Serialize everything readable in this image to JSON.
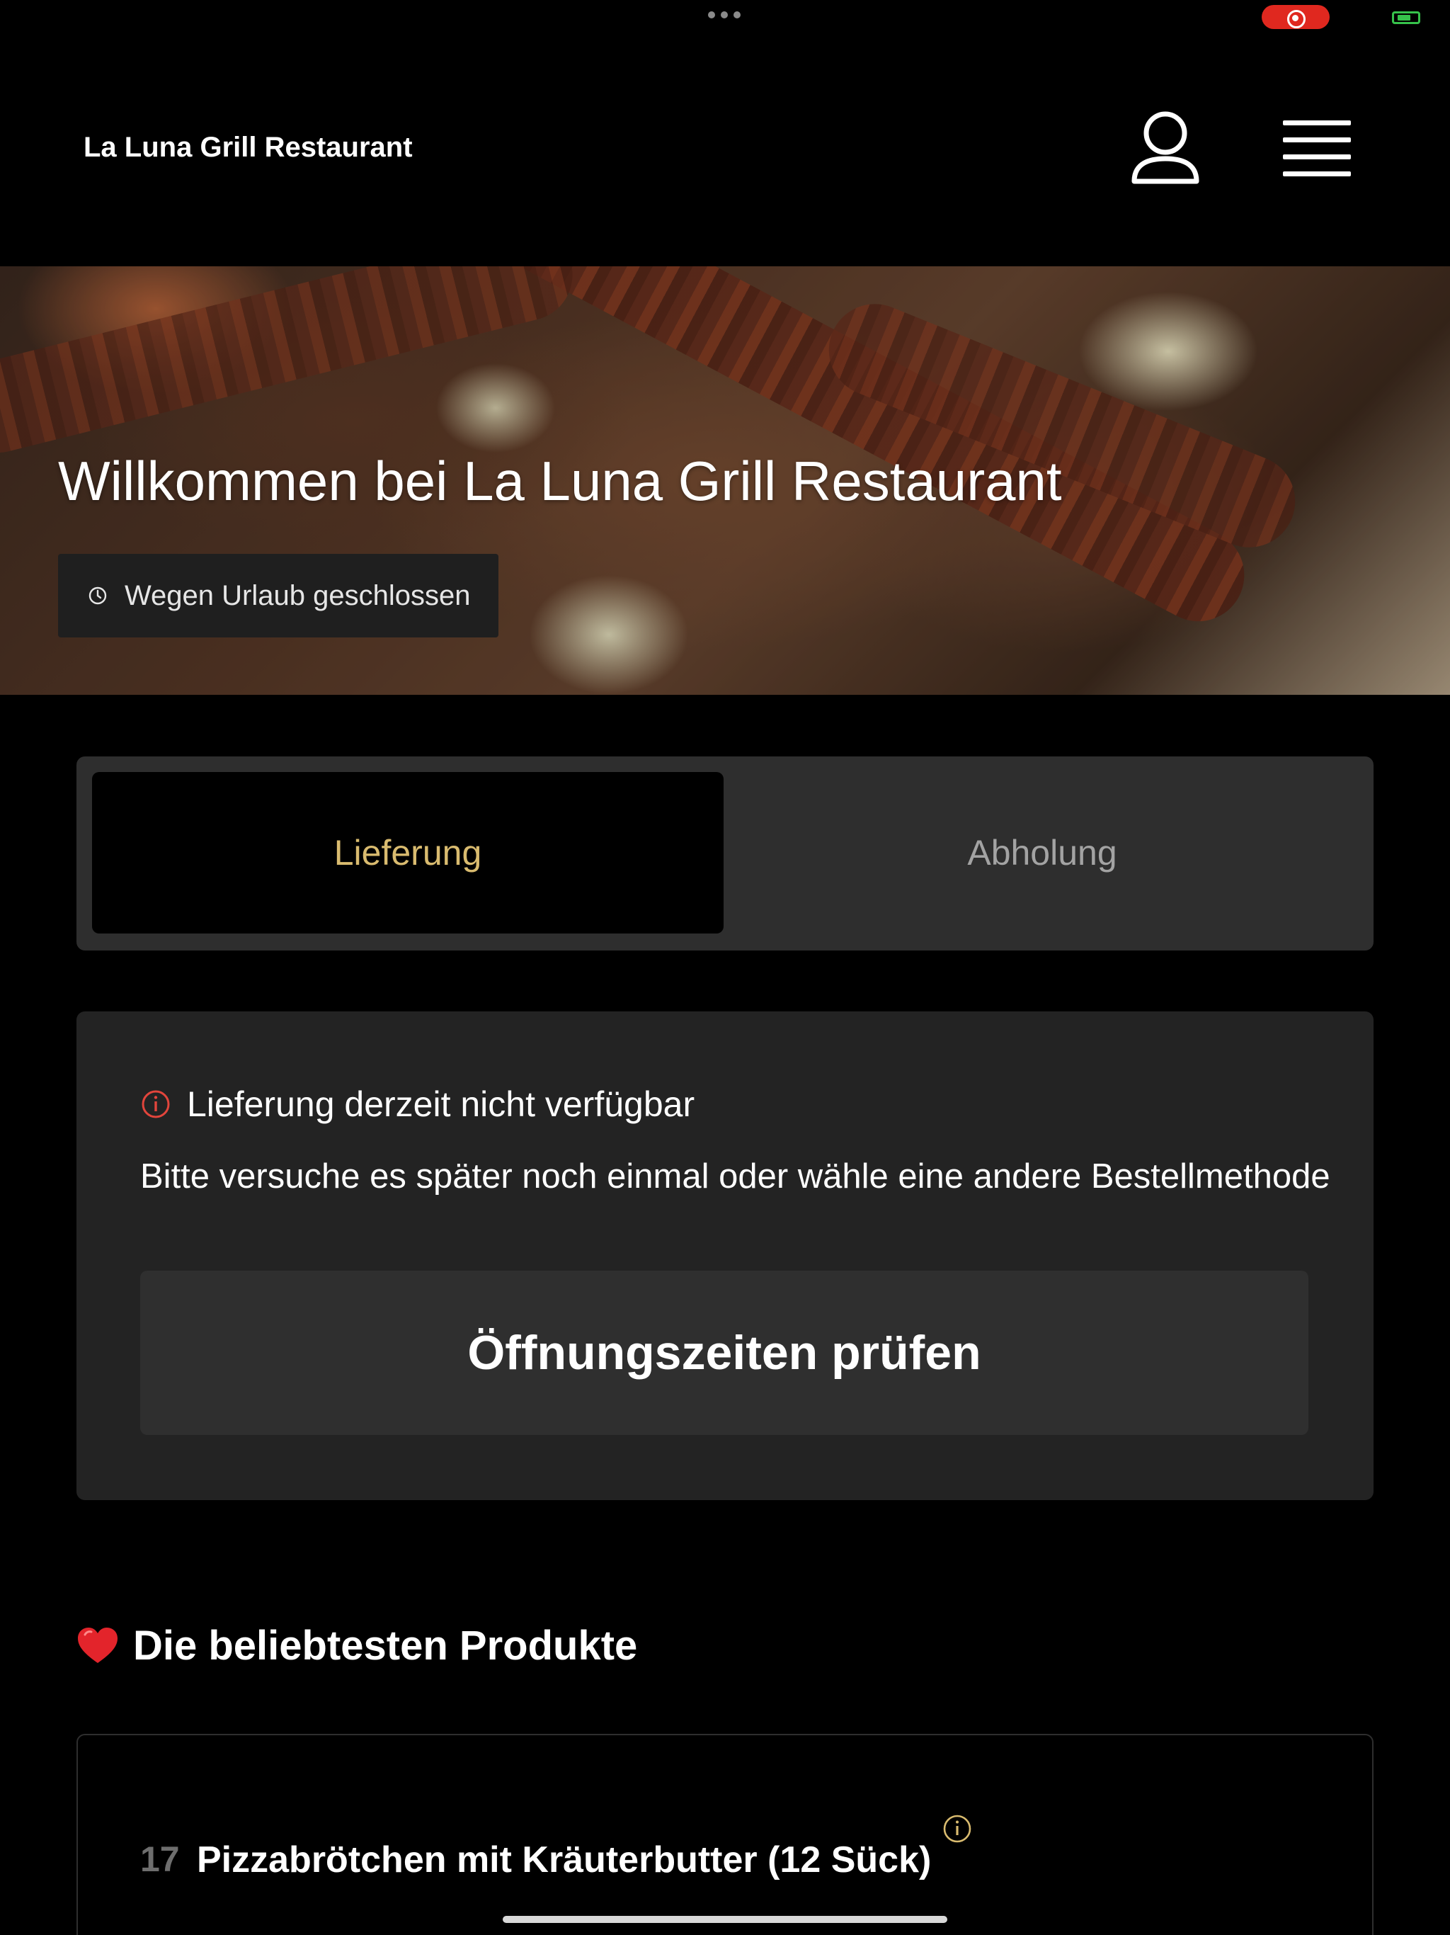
{
  "header": {
    "brand": "La Luna Grill Restaurant",
    "user_icon": "user-icon",
    "menu_icon": "hamburger-menu-icon"
  },
  "hero": {
    "title": "Willkommen bei La Luna Grill Restaurant",
    "status_text": "Wegen Urlaub geschlossen",
    "status_icon": "clock-icon"
  },
  "order_tabs": {
    "items": [
      {
        "label": "Lieferung",
        "active": true
      },
      {
        "label": "Abholung",
        "active": false
      }
    ],
    "active_color": "#d9bb6f"
  },
  "notice": {
    "icon": "info-icon",
    "title": "Lieferung derzeit nicht verfügbar",
    "body": "Bitte versuche es später noch einmal oder wähle eine andere Bestellmethode",
    "button_label": "Öffnungszeiten prüfen",
    "icon_color": "#e2453c"
  },
  "popular": {
    "title": "Die beliebtesten Produkte",
    "icon": "heart-icon",
    "products": [
      {
        "number": "17",
        "name": "Pizzabrötchen mit Kräuterbutter (12 Sück)",
        "info_icon": "info-icon"
      }
    ]
  }
}
